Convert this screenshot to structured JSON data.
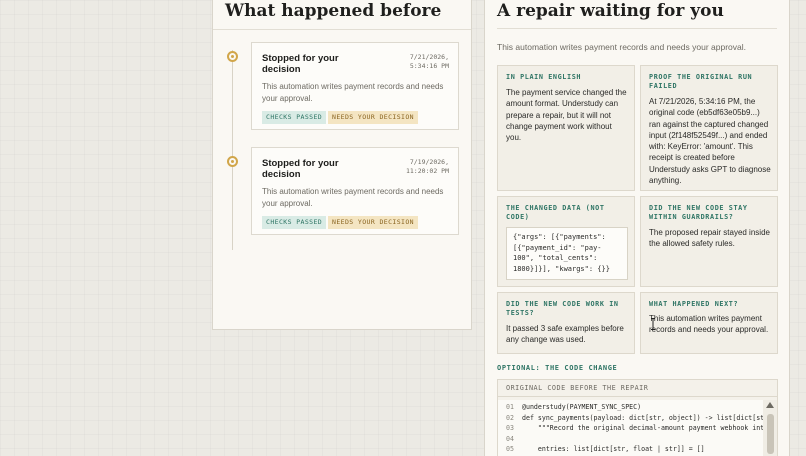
{
  "left": {
    "title": "What happened before",
    "events": [
      {
        "title": "Stopped for your decision",
        "time": "7/21/2026, 5:34:16 PM",
        "description": "This automation writes payment records and needs your approval.",
        "badges": [
          "CHECKS PASSED",
          "NEEDS YOUR DECISION"
        ]
      },
      {
        "title": "Stopped for your decision",
        "time": "7/19/2026, 11:20:02 PM",
        "description": "This automation writes payment records and needs your approval.",
        "badges": [
          "CHECKS PASSED",
          "NEEDS YOUR DECISION"
        ]
      }
    ]
  },
  "right": {
    "title": "A repair waiting for you",
    "subtitle": "This automation writes payment records and needs your approval.",
    "boxes": {
      "plain_english": {
        "label": "IN PLAIN ENGLISH",
        "text": "The payment service changed the amount format. Understudy can prepare a repair, but it will not change payment work without you."
      },
      "proof": {
        "label": "PROOF THE ORIGINAL RUN FAILED",
        "text": "At 7/21/2026, 5:34:16 PM, the original code (eb5df63e05b9...) ran against the captured changed input (2f148f52549f...) and ended with: KeyError: 'amount'. This receipt is created before Understudy asks GPT to diagnose anything."
      },
      "changed_data": {
        "label": "THE CHANGED DATA (NOT CODE)",
        "code": "{\"args\": [{\"payments\": [{\"payment_id\": \"pay-100\", \"total_cents\": 1800}]}], \"kwargs\": {}}"
      },
      "guardrails": {
        "label": "DID THE NEW CODE STAY WITHIN GUARDRAILS?",
        "text": "The proposed repair stayed inside the allowed safety rules."
      },
      "tests": {
        "label": "DID THE NEW CODE WORK IN TESTS?",
        "text": "It passed 3 safe examples before any change was used."
      },
      "next": {
        "label": "WHAT HAPPENED NEXT?",
        "text": "This automation writes payment records and needs your approval."
      }
    },
    "optional_label": "OPTIONAL: THE CODE CHANGE",
    "code_panel": {
      "header": "ORIGINAL CODE BEFORE THE REPAIR",
      "lines": [
        {
          "n": "01",
          "code": "@understudy(PAYMENT_SYNC_SPEC)"
        },
        {
          "n": "02",
          "code": "def sync_payments(payload: dict[str, object]) -> list[dict[str,"
        },
        {
          "n": "03",
          "code": "    \"\"\"Record the original decimal-amount payment webhook into a"
        },
        {
          "n": "04",
          "code": ""
        },
        {
          "n": "05",
          "code": "    entries: list[dict[str, float | str]] = []"
        }
      ]
    }
  },
  "colors": {
    "accent_teal": "#2f7565",
    "accent_gold": "#d1a64a",
    "panel_bg": "#faf8f3",
    "box_bg": "#f2efe7"
  }
}
